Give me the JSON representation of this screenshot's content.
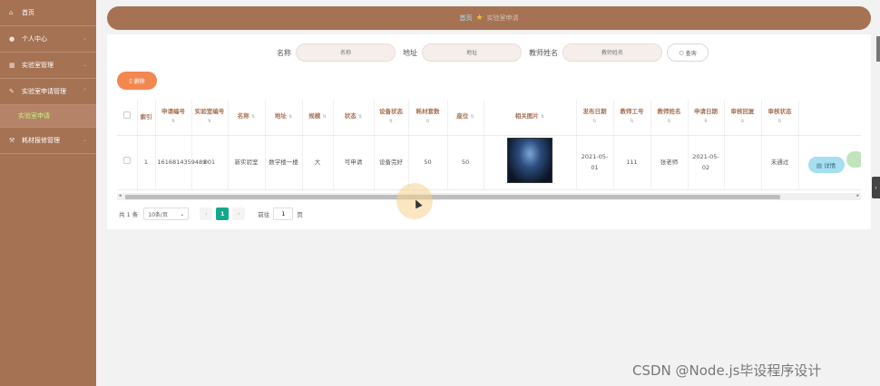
{
  "sidebar": {
    "items": [
      {
        "label": "首页",
        "icon": "home-icon"
      },
      {
        "label": "个人中心",
        "icon": "user-icon"
      },
      {
        "label": "实验室管理",
        "icon": "building-icon"
      },
      {
        "label": "实验室申请管理",
        "icon": "wrench-icon"
      },
      {
        "label": "实验室申请",
        "icon": ""
      },
      {
        "label": "耗材报修管理",
        "icon": "tool-icon"
      }
    ]
  },
  "breadcrumb": {
    "home": "首页",
    "current": "实验室申请"
  },
  "search": {
    "name_label": "名称",
    "name_placeholder": "名称",
    "addr_label": "地址",
    "addr_placeholder": "地址",
    "teacher_label": "教师姓名",
    "teacher_placeholder": "教师姓名",
    "button": "查询"
  },
  "toolbar": {
    "delete": "删除"
  },
  "table": {
    "headers": [
      "索引",
      "申请编号",
      "实验室编号",
      "名称",
      "地址",
      "规模",
      "状态",
      "设备状态",
      "耗材套数",
      "座位",
      "相关图片",
      "发布日期",
      "教师工号",
      "教师姓名",
      "申请日期",
      "审核回复",
      "审核状态",
      ""
    ],
    "row": {
      "index": "1",
      "app_no": "1616814359489",
      "lab_no": "001",
      "name": "新实验室",
      "address": "数学楼一楼",
      "scale": "大",
      "status": "可申请",
      "device": "设备完好",
      "kits": "50",
      "seats": "50",
      "publish": "2021-05-01",
      "teacher_id": "111",
      "teacher_name": "张老师",
      "apply_date": "2021-05-02",
      "reply": "",
      "audit": "未通过",
      "detail_btn": "详情"
    }
  },
  "pager": {
    "total": "共 1 条",
    "size": "10条/页",
    "page": "1",
    "goto": "前往",
    "goto_value": "1",
    "unit": "页"
  },
  "watermark": "CSDN @Node.js毕设程序设计"
}
